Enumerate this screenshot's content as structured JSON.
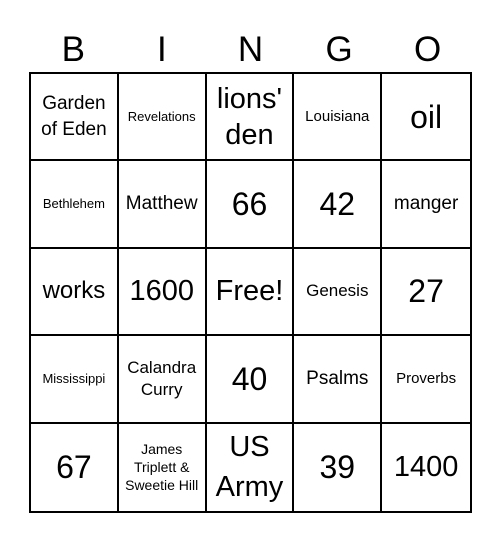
{
  "header": {
    "letters": [
      "B",
      "I",
      "N",
      "G",
      "O"
    ]
  },
  "grid": {
    "rows": [
      [
        "Garden of Eden",
        "Revelations",
        "lions' den",
        "Louisiana",
        "oil"
      ],
      [
        "Bethlehem",
        "Matthew",
        "66",
        "42",
        "manger"
      ],
      [
        "works",
        "1600",
        "Free!",
        "Genesis",
        "27"
      ],
      [
        "Mississippi",
        "Calandra Curry",
        "40",
        "Psalms",
        "Proverbs"
      ],
      [
        "67",
        "James Triplett & Sweetie Hill",
        "US Army",
        "39",
        "1400"
      ]
    ]
  }
}
